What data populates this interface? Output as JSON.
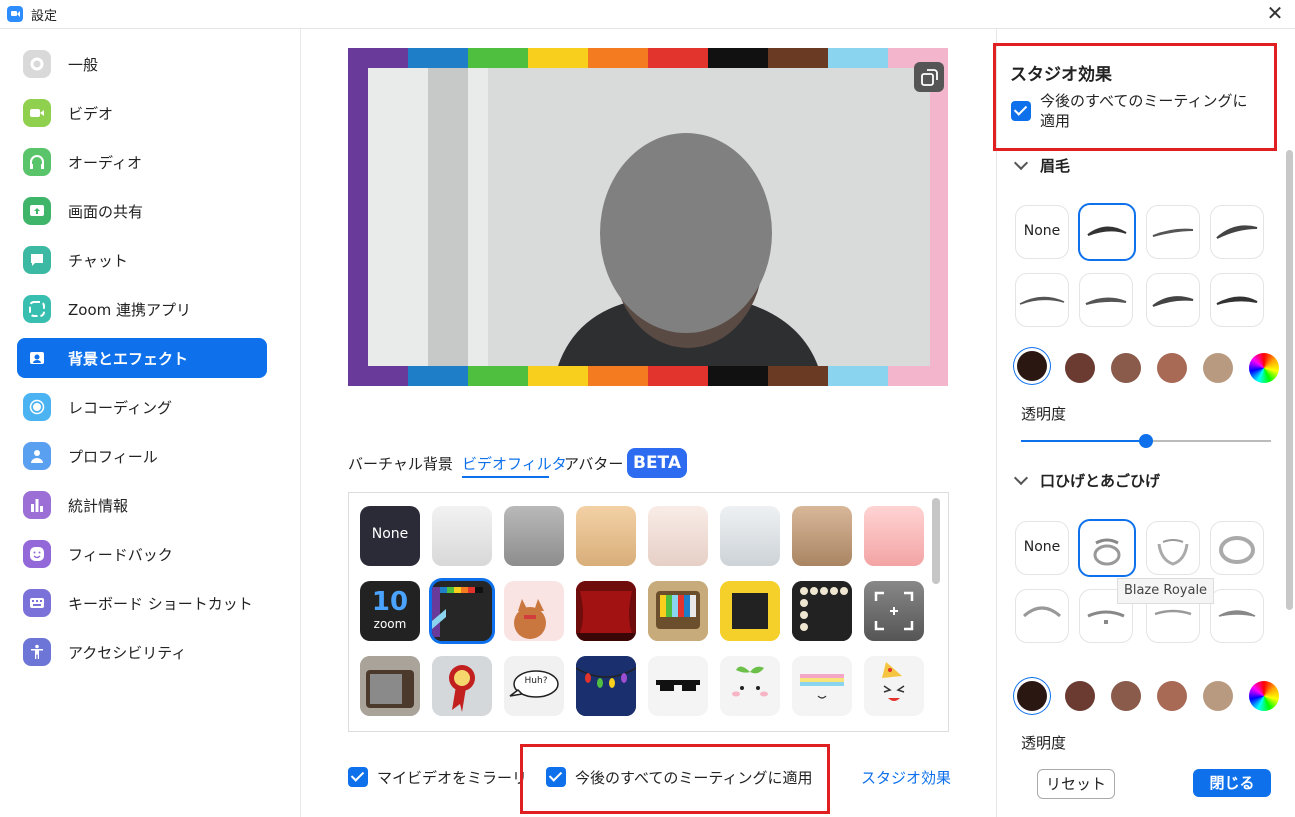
{
  "window": {
    "title": "設定",
    "close_label": "✕"
  },
  "sidebar": {
    "items": [
      {
        "label": "一般",
        "icon": "gear-icon",
        "color": "#d9d9d9"
      },
      {
        "label": "ビデオ",
        "icon": "video-camera-icon",
        "color": "#8fd14f"
      },
      {
        "label": "オーディオ",
        "icon": "headphones-icon",
        "color": "#5ac46a"
      },
      {
        "label": "画面の共有",
        "icon": "share-screen-icon",
        "color": "#3fb56a"
      },
      {
        "label": "チャット",
        "icon": "chat-bubble-icon",
        "color": "#3cb9a3"
      },
      {
        "label": "Zoom 連携アプリ",
        "icon": "apps-icon",
        "color": "#39bfb0"
      },
      {
        "label": "背景とエフェクト",
        "icon": "background-icon",
        "color": "#0e71eb"
      },
      {
        "label": "レコーディング",
        "icon": "record-icon",
        "color": "#4bb3f2"
      },
      {
        "label": "プロフィール",
        "icon": "profile-icon",
        "color": "#5aa0f0"
      },
      {
        "label": "統計情報",
        "icon": "statistics-icon",
        "color": "#9c6fd6"
      },
      {
        "label": "フィードバック",
        "icon": "feedback-icon",
        "color": "#9368d8"
      },
      {
        "label": "キーボード ショートカット",
        "icon": "keyboard-icon",
        "color": "#7a72d8"
      },
      {
        "label": "アクセシビリティ",
        "icon": "accessibility-icon",
        "color": "#6d75d6"
      }
    ]
  },
  "main": {
    "tabs": [
      {
        "label": "バーチャル背景"
      },
      {
        "label": "ビデオフィルタ"
      },
      {
        "label": "アバター"
      }
    ],
    "beta_label": "BETA",
    "filters": {
      "none_label": "None",
      "zoom_tile_number": "10",
      "zoom_tile_word": "zoom",
      "speech_bubble_text": "Huh?"
    },
    "mirror_label": "マイビデオをミラーリング",
    "apply_all_label": "今後のすべてのミーティングに適用",
    "studio_link": "スタジオ効果"
  },
  "panel": {
    "title": "スタジオ効果",
    "apply_all_label": "今後のすべてのミーティングに適用",
    "eyebrow_title": "眉毛",
    "beard_title": "口ひげとあごひげ",
    "none_label": "None",
    "opacity_label": "透明度",
    "opacity_value": 0.5,
    "swatches": [
      "#2a1712",
      "#6b3a30",
      "#8a5a4a",
      "#a86a55",
      "#b89a80"
    ],
    "tooltip": "Blaze Royale",
    "reset_label": "リセット",
    "close_label": "閉じる"
  }
}
